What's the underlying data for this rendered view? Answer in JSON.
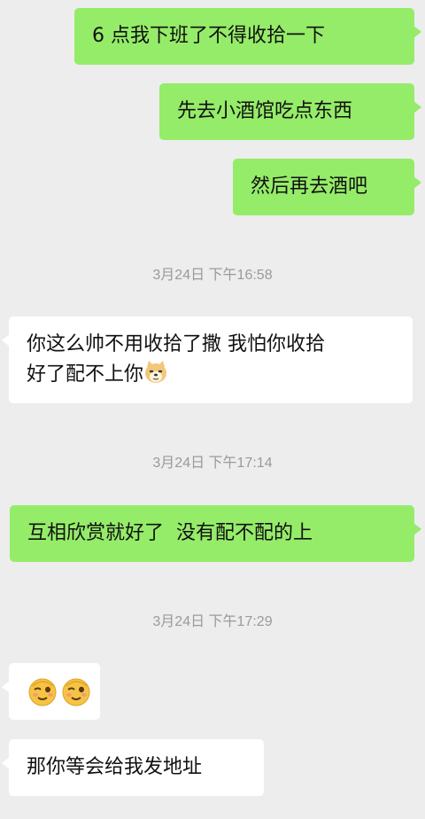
{
  "messages": [
    {
      "direction": "sent",
      "text": "6 点我下班了不得收拾一下"
    },
    {
      "direction": "sent",
      "text": "先去小酒馆吃点东西"
    },
    {
      "direction": "sent",
      "text": "然后再去酒吧"
    },
    {
      "type": "timestamp",
      "text": "3月24日 下午16:58"
    },
    {
      "direction": "received",
      "line1": "你这么帅不用收拾了撒 我怕你收拾",
      "line2": "好了配不上你",
      "emoji": "doge-emoji"
    },
    {
      "type": "timestamp",
      "text": "3月24日 下午17:14"
    },
    {
      "direction": "sent",
      "text": "互相欣赏就好了  没有配不配的上"
    },
    {
      "type": "timestamp",
      "text": "3月24日 下午17:29"
    },
    {
      "direction": "received",
      "emojis": [
        "wink-emoji",
        "wink-emoji"
      ]
    },
    {
      "direction": "received",
      "text": "那你等会给我发地址"
    }
  ],
  "colors": {
    "background": "#ededed",
    "sent_bubble": "#95ec69",
    "received_bubble": "#ffffff",
    "timestamp_text": "#9a9a9a"
  }
}
